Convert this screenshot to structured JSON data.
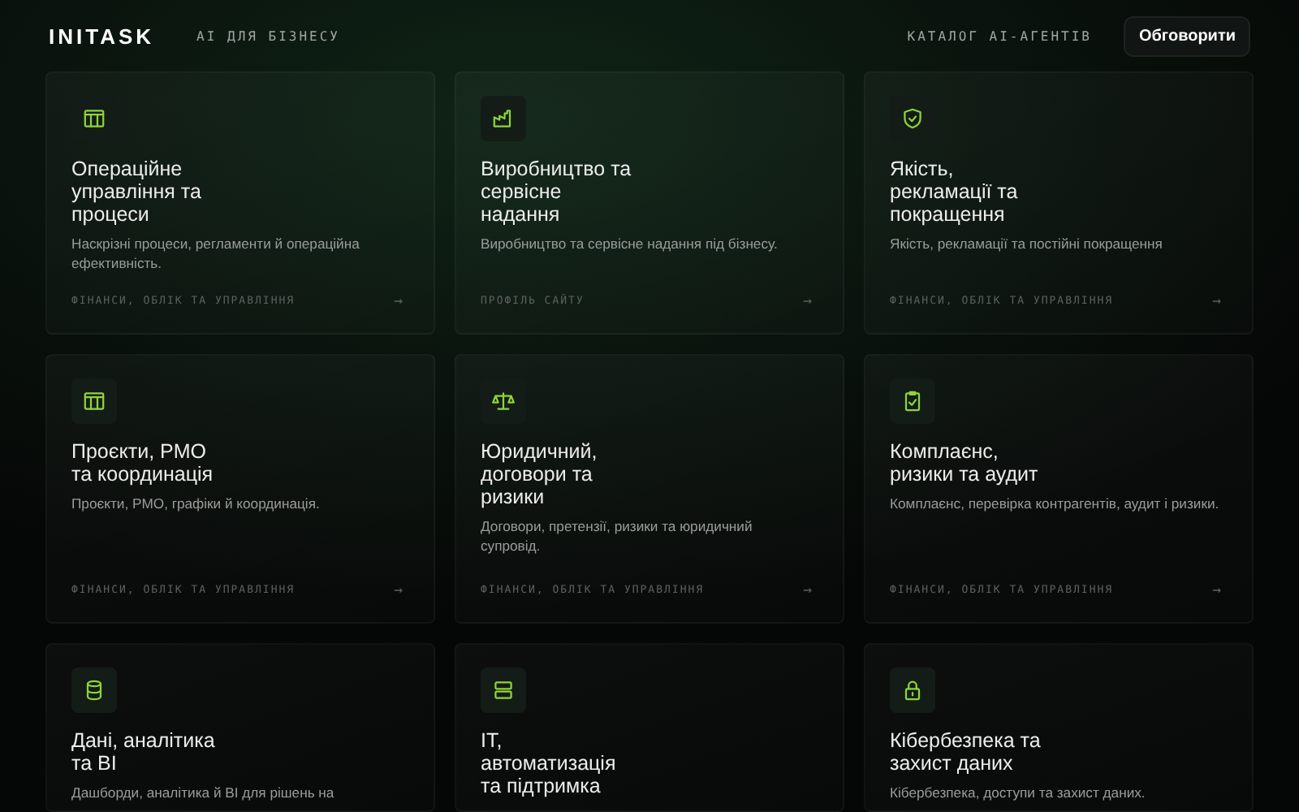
{
  "header": {
    "logo": "INITASK",
    "tagline": "AI ДЛЯ БІЗНЕСУ",
    "nav_link": "КАТАЛОГ AI-АГЕНТІВ",
    "cta_button": "Обговорити"
  },
  "cards": [
    {
      "title_lines": [
        "Операційне",
        "управління та",
        "процеси"
      ],
      "description": "Наскрізні процеси, регламенти й операційна ефективність.",
      "footer": "ФІНАНСИ, ОБЛІК ТА УПРАВЛІННЯ",
      "arrow": "→"
    },
    {
      "title_lines": [
        "Виробництво та",
        "сервісне",
        "надання"
      ],
      "description": "Виробництво та сервісне надання під бізнесу.",
      "footer": "ПРОФІЛЬ САЙТУ",
      "arrow": "→"
    },
    {
      "title_lines": [
        "Якість,",
        "рекламації та",
        "покращення"
      ],
      "description": "Якість, рекламації та постійні покращення",
      "footer": "ФІНАНСИ, ОБЛІК ТА УПРАВЛІННЯ",
      "arrow": "→"
    },
    {
      "title_lines": [
        "Проєкти, PMO",
        "та координація"
      ],
      "description": "Проєкти, PMO, графіки й координація.",
      "footer": "ФІНАНСИ, ОБЛІК ТА УПРАВЛІННЯ",
      "arrow": "→"
    },
    {
      "title_lines": [
        "Юридичний,",
        "договори та",
        "ризики"
      ],
      "description": "Договори, претензії, ризики та юридичний супровід.",
      "footer": "ФІНАНСИ, ОБЛІК ТА УПРАВЛІННЯ",
      "arrow": "→"
    },
    {
      "title_lines": [
        "Комплаєнс,",
        "ризики та аудит"
      ],
      "description": "Комплаєнс, перевірка контрагентів, аудит і ризики.",
      "footer": "ФІНАНСИ, ОБЛІК ТА УПРАВЛІННЯ",
      "arrow": "→"
    },
    {
      "title_lines": [
        "Дані, аналітика",
        "та BI"
      ],
      "description": "Дашборди, аналітика й BI для рішень на"
    },
    {
      "title_lines": [
        "IT,",
        "автоматизація",
        "та підтримка"
      ]
    },
    {
      "title_lines": [
        "Кібербезпека та",
        "захист даних"
      ],
      "description": "Кібербезпека, доступи та захист даних."
    }
  ]
}
